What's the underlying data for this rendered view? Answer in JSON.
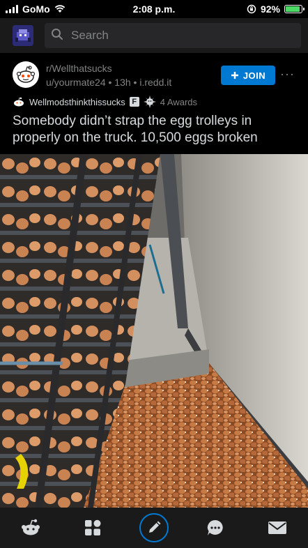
{
  "status": {
    "carrier": "GoMo",
    "time": "2:08 p.m.",
    "battery_percent": "92%",
    "battery_level": 0.92
  },
  "search": {
    "placeholder": "Search"
  },
  "post": {
    "subreddit": "r/Wellthatsucks",
    "author": "u/yourmate24",
    "age": "13h",
    "domain": "i.redd.it",
    "join_label": "JOIN",
    "flair": "Wellmodsthinkthissucks",
    "flair_badge": "F",
    "awards": "4 Awards",
    "title": "Somebody didn’t strap the egg trolleys in properly on the truck. 10,500 eggs broken"
  },
  "icons": {
    "home": "reddit-snoo-icon",
    "communities": "communities-icon",
    "create": "pencil-icon",
    "chat": "chat-icon",
    "inbox": "mail-icon"
  },
  "colors": {
    "accent": "#0079d3",
    "background": "#000000",
    "surface": "#1a1a1b",
    "battery": "#4cd964"
  }
}
